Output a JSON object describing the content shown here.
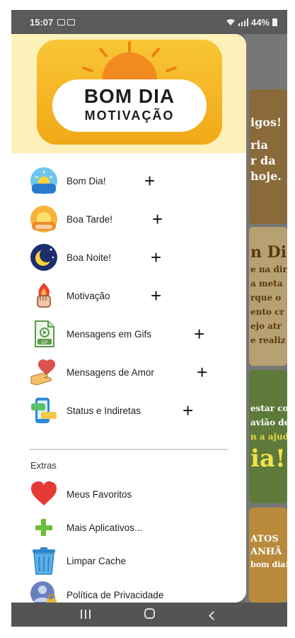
{
  "status_bar": {
    "time": "15:07",
    "battery": "44%"
  },
  "logo": {
    "title": "BOM DIA",
    "subtitle": "MOTIVAÇÃO"
  },
  "menu": {
    "items": [
      {
        "label": "Bom Dia!",
        "icon": "sunrise-icon",
        "expandable": true
      },
      {
        "label": "Boa Tarde!",
        "icon": "sunset-icon",
        "expandable": true
      },
      {
        "label": "Boa Noite!",
        "icon": "moon-icon",
        "expandable": true
      },
      {
        "label": "Motivação",
        "icon": "fist-flame-icon",
        "expandable": true
      },
      {
        "label": "Mensagens em Gifs",
        "icon": "gif-file-icon",
        "expandable": true
      },
      {
        "label": "Mensagens de Amor",
        "icon": "hand-heart-icon",
        "expandable": true
      },
      {
        "label": "Status e Indiretas",
        "icon": "phone-chat-icon",
        "expandable": true
      }
    ],
    "plus_symbol": "+"
  },
  "extras": {
    "title": "Extras",
    "items": [
      {
        "label": "Meus Favoritos",
        "icon": "heart-icon"
      },
      {
        "label": "Mais Aplicativos...",
        "icon": "green-plus-icon"
      },
      {
        "label": "Limpar Cache",
        "icon": "trash-icon"
      },
      {
        "label": "Política de Privacidade",
        "icon": "user-lock-icon"
      }
    ]
  },
  "background_cards": [
    {
      "lines": [
        "igos!",
        "ria",
        "r da",
        "hoje."
      ]
    },
    {
      "lines": [
        "n Di",
        "e na dir",
        "a meta",
        "rque o",
        "ento cr",
        "ejo atr",
        "e realiz"
      ]
    },
    {
      "lines": [
        "estar co",
        "avião de",
        "n a ajuda",
        "ia!"
      ]
    },
    {
      "lines": [
        "ATOS",
        "ANHÃ",
        "bom dia!"
      ]
    }
  ],
  "colors": {
    "drawer_bg": "#ffffff",
    "header_bg": "#fdf0b8",
    "logo_yellow": "#f8c636",
    "sun_orange": "#f28b1f",
    "heart_red": "#e53935",
    "plus_green": "#6abf3a"
  }
}
